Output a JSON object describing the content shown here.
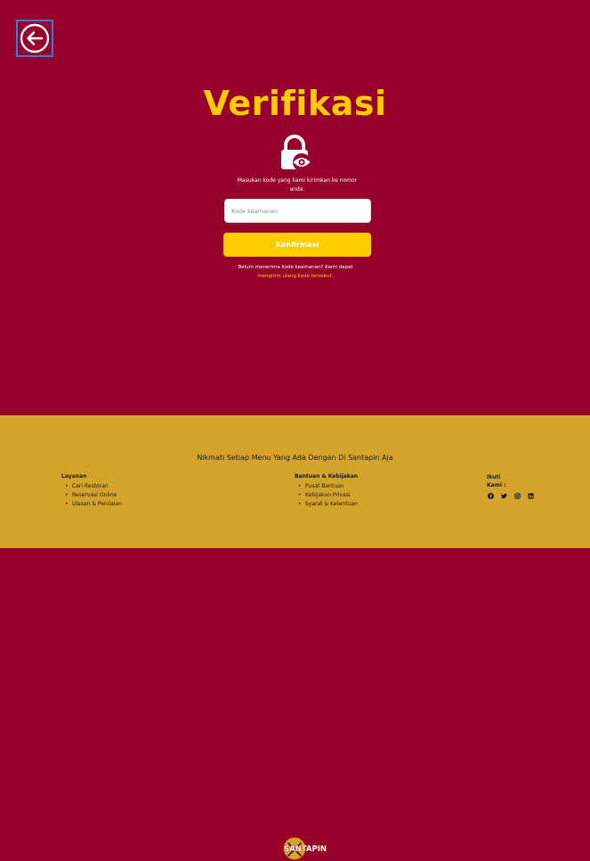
{
  "page": {
    "title": "Verifikasi",
    "description": "Masukan kode yang kami kirimkan ke nomor anda.",
    "input_placeholder": "Kode keamanan",
    "confirm_label": "Konfirmasi",
    "resend_text": "Belum menerima kode keamanan? Kami dapat",
    "resend_link": "mengirim ulang kode tersebut."
  },
  "icons": {
    "back": "arrow-left-circle-icon",
    "lock": "lock-eye-icon"
  },
  "footer": {
    "logo_text": "SANTAPIN",
    "tagline": "Nikmati Setiap Menu Yang Ada Dengan Di Santapin Aja",
    "layanan": {
      "heading": "Layanan",
      "items": [
        "Cari Restoran",
        "Reservasi Online",
        "Ulasan & Penilaian"
      ]
    },
    "bantuan": {
      "heading": "Bantuan & Kebijakan",
      "items": [
        "Pusat Bantuan",
        "Kebijakan Privasi",
        "Syarat & Ketentuan"
      ]
    },
    "social": {
      "heading": "Ikuti Kami :",
      "icons": [
        "facebook-icon",
        "twitter-icon",
        "instagram-icon",
        "linkedin-icon"
      ]
    }
  },
  "colors": {
    "background": "#96002a",
    "accent": "#ffcc00",
    "footer": "#d4a32a",
    "focus_border": "#2f7fe0"
  }
}
